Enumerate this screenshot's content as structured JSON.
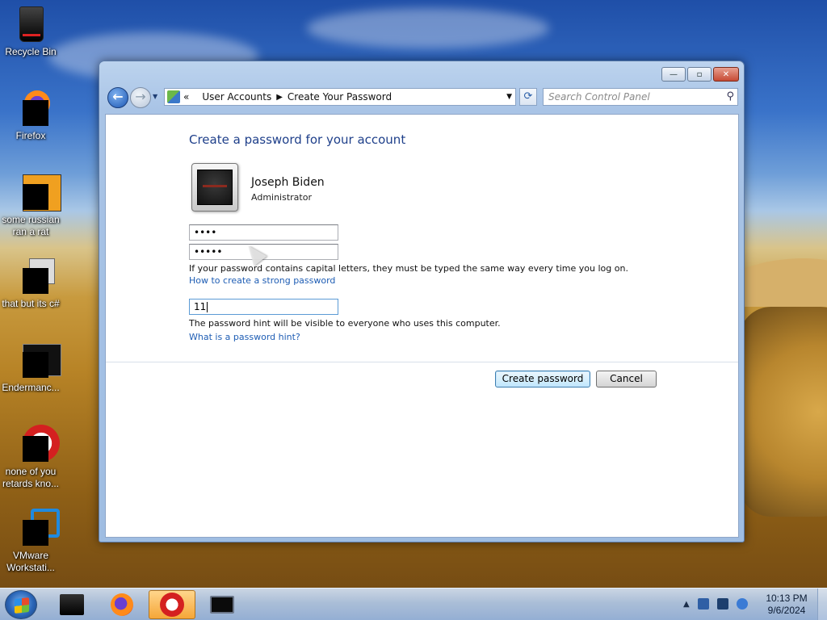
{
  "desktop": {
    "icons": [
      {
        "label": "Recycle Bin"
      },
      {
        "label": "Firefox"
      },
      {
        "label": "some russian ran a rat"
      },
      {
        "label": "that but its c#"
      },
      {
        "label": "Endermanc..."
      },
      {
        "label": "none of you retards kno..."
      },
      {
        "label": "VMware Workstati..."
      }
    ]
  },
  "window": {
    "controls": {
      "minimize": "—",
      "maximize": "▫",
      "close": "✕"
    },
    "nav": {
      "back": "←",
      "forward": "→"
    },
    "breadcrumb": {
      "prefix": "«",
      "items": [
        "User Accounts",
        "Create Your Password"
      ]
    },
    "search": {
      "placeholder": "Search Control Panel"
    },
    "content": {
      "heading": "Create a password for your account",
      "user": {
        "name": "Joseph Biden",
        "role": "Administrator"
      },
      "fields": {
        "new_password": "••••",
        "confirm_password": "•••••",
        "hint": "11"
      },
      "caps_note": "If your password contains capital letters, they must be typed the same way every time you log on.",
      "strong_link": "How to create a strong password",
      "hint_note": "The password hint will be visible to everyone who uses this computer.",
      "hint_link": "What is a password hint?",
      "buttons": {
        "create": "Create password",
        "cancel": "Cancel"
      }
    }
  },
  "taskbar": {
    "clock": {
      "time": "10:13 PM",
      "date": "9/6/2024"
    },
    "tray_arrow": "▲"
  }
}
